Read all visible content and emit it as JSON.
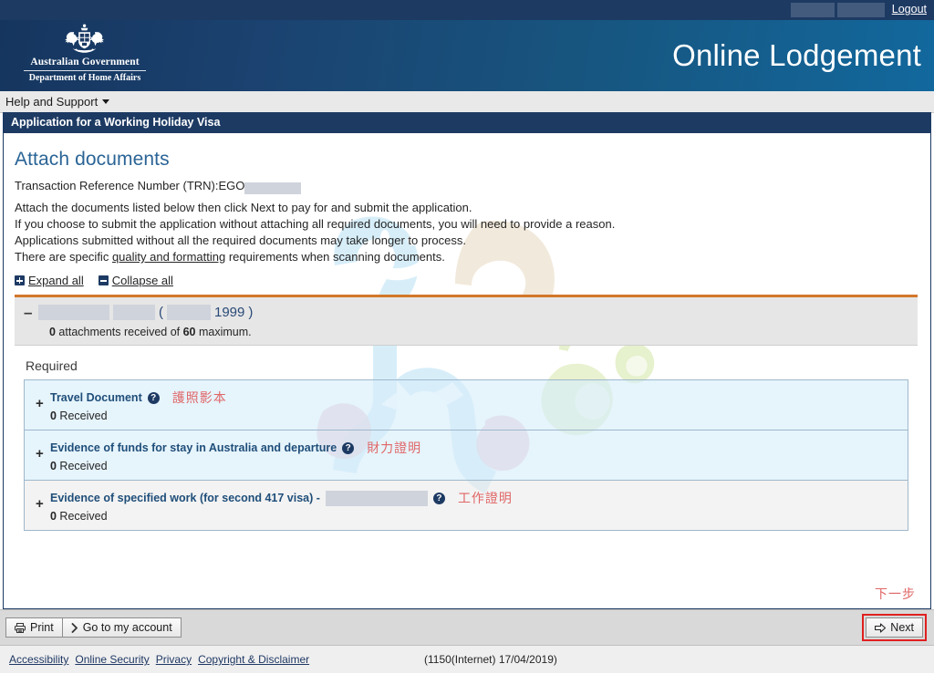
{
  "topbar": {
    "logout_label": "Logout",
    "redactions": 2
  },
  "header": {
    "crest_line1": "Australian Government",
    "crest_line2": "Department of Home Affairs",
    "crest_icon": "australian-coat-of-arms",
    "title": "Online Lodgement"
  },
  "helpnav": {
    "item_label": "Help and Support",
    "caret_icon": "chevron-down-icon"
  },
  "app": {
    "titlebar": "Application for a Working Holiday Visa"
  },
  "main": {
    "page_title": "Attach documents",
    "trn_label": "Transaction Reference Number (TRN):EGO",
    "paragraphs": [
      "Attach the documents listed below then click Next to pay for and submit the application.",
      "If you choose to submit the application without attaching all required documents, you will need to provide a reason.",
      "Applications submitted without all the required documents may take longer to process."
    ],
    "quality_sentence_pre": "There are specific ",
    "quality_link": "quality and formatting",
    "quality_sentence_post": " requirements when scanning documents.",
    "expand_all": "Expand all",
    "collapse_all": "Collapse all",
    "expand_icon": "plus-square-icon",
    "collapse_icon": "minus-square-icon"
  },
  "accordion": {
    "toggle_glyph": "–",
    "applicant_dob_year": "1999",
    "paren_open": "(",
    "paren_close": ")",
    "attachments_count": "0",
    "attachments_mid": " attachments received of ",
    "attachments_max": "60",
    "attachments_suffix": " maximum.",
    "required_label": "Required"
  },
  "documents": [
    {
      "toggle_glyph": "+",
      "name": "Travel Document",
      "help_icon": "help-circle-icon",
      "help_glyph": "?",
      "annotation": "護照影本",
      "received_count": "0",
      "received_label": " Received",
      "has_redaction": false
    },
    {
      "toggle_glyph": "+",
      "name": "Evidence of funds for stay in Australia and departure",
      "help_icon": "help-circle-icon",
      "help_glyph": "?",
      "annotation": "財力證明",
      "received_count": "0",
      "received_label": " Received",
      "has_redaction": false
    },
    {
      "toggle_glyph": "+",
      "name": "Evidence of specified work (for second 417 visa) -",
      "help_icon": "help-circle-icon",
      "help_glyph": "?",
      "annotation": "工作證明",
      "received_count": "0",
      "received_label": " Received",
      "has_redaction": true
    }
  ],
  "annotations": {
    "next_hint": "下一步"
  },
  "actionbar": {
    "print_label": "Print",
    "print_icon": "printer-icon",
    "account_label": "Go to my account",
    "account_icon": "chevron-right-icon",
    "next_label": "Next",
    "next_icon": "arrow-right-block-icon"
  },
  "footer": {
    "links": [
      "Accessibility",
      "Online Security",
      "Privacy",
      "Copyright & Disclaimer"
    ],
    "version": "(1150(Internet) 17/04/2019)"
  },
  "colors": {
    "navy": "#1d3a63",
    "accent_orange": "#d2772a",
    "annotation_red": "#e06666",
    "highlight_red": "#e02020",
    "link_blue": "#2a6496"
  }
}
